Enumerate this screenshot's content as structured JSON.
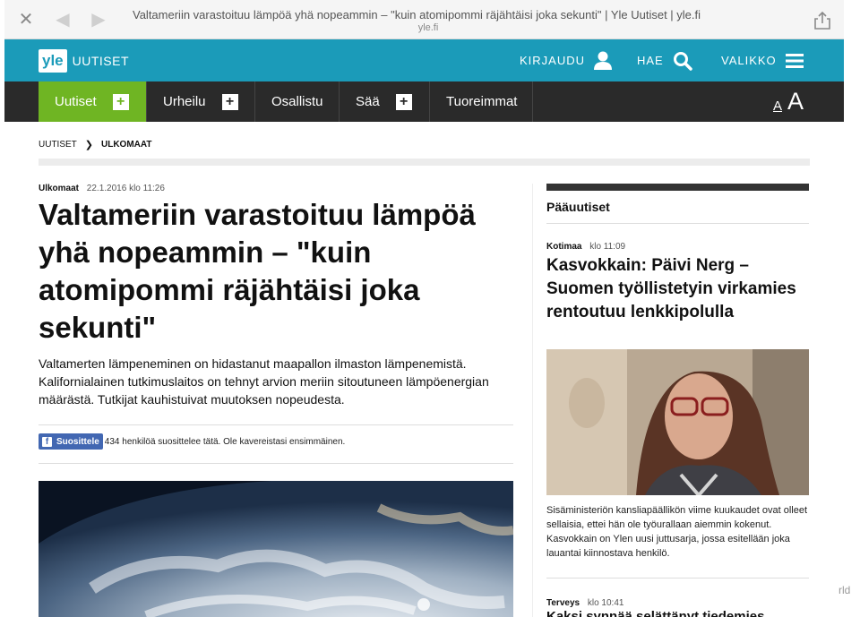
{
  "browser": {
    "page_title": "Valtameriin varastoituu lämpöä yhä nopeammin – \"kuin atomipommi räjähtäisi joka sekunti\" | Yle Uutiset | yle.fi",
    "host": "yle.fi",
    "icons": [
      "close-icon",
      "back-icon",
      "forward-icon",
      "share-icon"
    ]
  },
  "header": {
    "logo_box": "yle",
    "logo_word": "UUTISET",
    "login_label": "KIRJAUDU",
    "search_label": "HAE",
    "menu_label": "VALIKKO",
    "color": "#1b9bb9"
  },
  "nav": {
    "items": [
      {
        "label": "Uutiset",
        "plus": "+"
      },
      {
        "label": "Urheilu",
        "plus": "+"
      },
      {
        "label": "Osallistu"
      },
      {
        "label": "Sää",
        "plus": "+"
      },
      {
        "label": "Tuoreimmat"
      }
    ],
    "font_small": "A",
    "font_large": "A",
    "active_color": "#6fb523"
  },
  "breadcrumb": {
    "root": "UUTISET",
    "current": "ULKOMAAT"
  },
  "article": {
    "section": "Ulkomaat",
    "datetime": "22.1.2016 klo 11:26",
    "headline": "Valtameriin varastoituu lämpöä yhä nopeammin – \"kuin atomipommi räjähtäisi joka sekunti\"",
    "lead": "Valtamerten lämpeneminen on hidastanut maapallon ilmaston lämpenemistä. Kalifornialainen tutkimuslaitos on tehnyt arvion meriin sitoutuneen lämpöenergian määrästä. Tutkijat kauhistuivat muutoksen nopeudesta.",
    "fb_button": "Suosittele",
    "fb_text": "434 henkilöä suosittelee tätä. Ole kavereistasi ensimmäinen."
  },
  "sidebar": {
    "heading": "Pääuutiset",
    "story1": {
      "section": "Kotimaa",
      "time": "klo 11:09",
      "title": "Kasvokkain: Päivi Nerg – Suomen työllistetyin virkamies rentoutuu lenkkipolulla",
      "summary": "Sisäministeriön kansliapäällikön viime kuukaudet ovat olleet sellaisia, ettei hän ole työurallaan aiemmin kokenut. Kasvokkain on Ylen uusi juttusarja, jossa esitellään joka lauantai kiinnostava henkilö."
    },
    "story2": {
      "section": "Terveys",
      "time": "klo 10:41",
      "title": "Kaksi synnää selättänyt tiedemies Simon"
    }
  },
  "gutter_text": "rld"
}
